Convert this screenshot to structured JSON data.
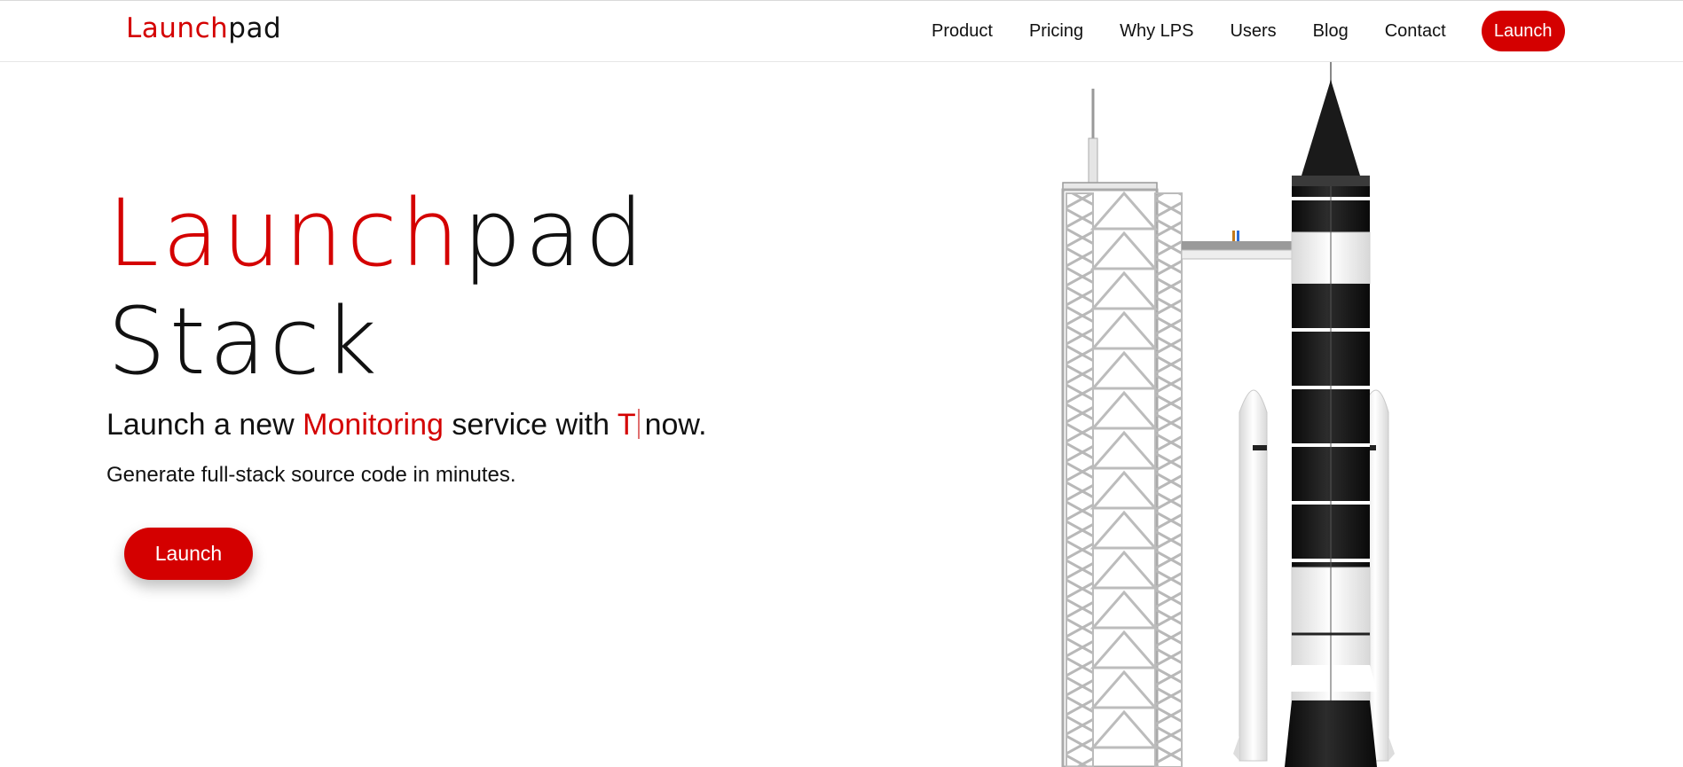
{
  "brand": {
    "name_red": "Launch",
    "name_black": "pad",
    "accent_color": "#d40000"
  },
  "nav": {
    "links": [
      "Product",
      "Pricing",
      "Why LPS",
      "Users",
      "Blog",
      "Contact"
    ],
    "cta": "Launch"
  },
  "hero": {
    "title_red": "Launch",
    "title_black": "pad",
    "title_line2": "Stack",
    "tagline_prefix": "Launch a new ",
    "tagline_highlight": "Monitoring",
    "tagline_middle": " service with ",
    "tagline_typed": "T",
    "tagline_suffix": "now.",
    "subtitle": "Generate full-stack source code in minutes.",
    "cta": "Launch"
  },
  "illustration": {
    "icon": "rocket-launch-tower-icon"
  }
}
